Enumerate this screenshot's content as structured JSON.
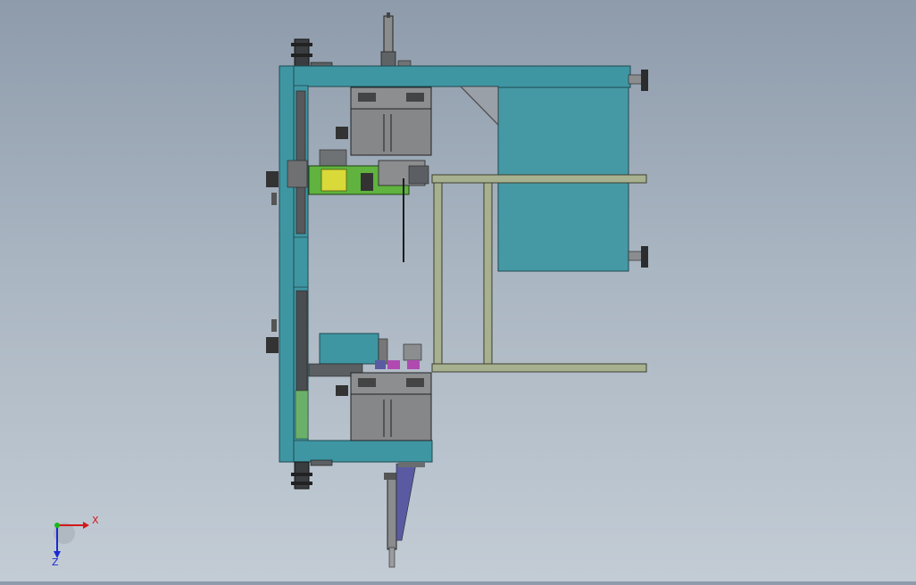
{
  "app": {
    "name": "CAD 3D viewport",
    "view": "top"
  },
  "triad": {
    "x_label": "X",
    "z_label": "Z",
    "x_color": "#d11a1a",
    "y_color": "#18b818",
    "z_color": "#1a2ad1"
  },
  "colors": {
    "background_top": "#8e9bab",
    "background_bottom": "#c3ccd5",
    "frame_teal": "#3f96a3",
    "guard_panel": "#4599a4",
    "olive_rail": "#a7b08f",
    "module_gray": "#8c8e90",
    "green_part": "#5fb33e",
    "yellow_part": "#d9d93a",
    "blue_part": "#5a5aa3",
    "magenta_part": "#b04ab0",
    "pale_green": "#6ab06a"
  }
}
